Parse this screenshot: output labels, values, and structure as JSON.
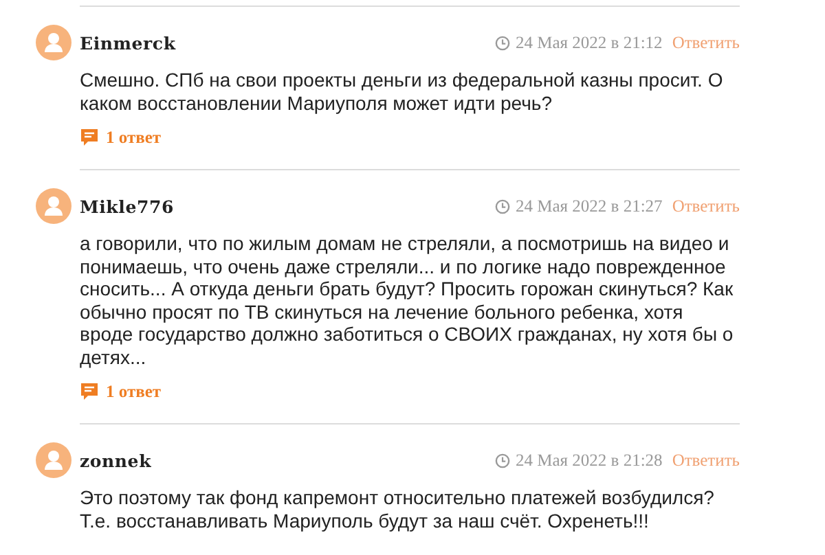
{
  "comments": [
    {
      "author": "Einmerck",
      "date": "24 Мая 2022 в 21:12",
      "reply_link": "Ответить",
      "text": "Смешно. СПб на свои проекты деньги из федеральной казны просит. О каком восстановлении Мариуполя может идти речь?",
      "replies": "1 ответ"
    },
    {
      "author": "Mikle776",
      "date": "24 Мая 2022 в 21:27",
      "reply_link": "Ответить",
      "text": "а говорили, что по жилым домам не стреляли, а посмотришь на видео и понимаешь, что очень даже стреляли... и по логике надо поврежденное сносить... А откуда деньги брать будут? Просить горожан скинуться? Как обычно просят по ТВ скинуться на лечение больного ребенка, хотя вроде государство должно заботиться о СВОИХ гражданах, ну хотя бы о детях...",
      "replies": "1 ответ"
    },
    {
      "author": "zonnek",
      "date": "24 Мая 2022 в 21:28",
      "reply_link": "Ответить",
      "text": "Это поэтому так фонд капремонт относительно платежей возбудился? Т.е. восстанавливать Мариуполь будут за наш счёт. Охренеть!!!"
    }
  ]
}
